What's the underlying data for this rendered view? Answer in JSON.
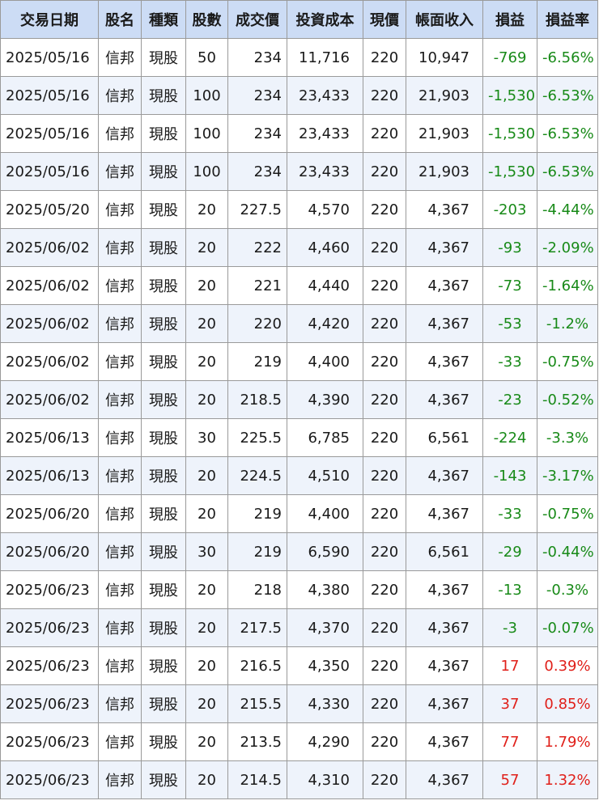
{
  "columns": [
    "交易日期",
    "股名",
    "種類",
    "股數",
    "成交價",
    "投資成本",
    "現價",
    "帳面收入",
    "損益",
    "損益率"
  ],
  "colors": {
    "header_bg": "#ccdcf5",
    "stock_name": "#1f3fcf",
    "type": "#e0201a",
    "loss": "#188a18",
    "gain": "#e0201a",
    "alt_row": "#eef3fb"
  },
  "rows": [
    {
      "date": "2025/05/16",
      "name": "信邦",
      "type": "現股",
      "shares": "50",
      "price": "234",
      "cost": "11,716",
      "current": "220",
      "book": "10,947",
      "pl": "-769",
      "plr": "-6.56%"
    },
    {
      "date": "2025/05/16",
      "name": "信邦",
      "type": "現股",
      "shares": "100",
      "price": "234",
      "cost": "23,433",
      "current": "220",
      "book": "21,903",
      "pl": "-1,530",
      "plr": "-6.53%"
    },
    {
      "date": "2025/05/16",
      "name": "信邦",
      "type": "現股",
      "shares": "100",
      "price": "234",
      "cost": "23,433",
      "current": "220",
      "book": "21,903",
      "pl": "-1,530",
      "plr": "-6.53%"
    },
    {
      "date": "2025/05/16",
      "name": "信邦",
      "type": "現股",
      "shares": "100",
      "price": "234",
      "cost": "23,433",
      "current": "220",
      "book": "21,903",
      "pl": "-1,530",
      "plr": "-6.53%"
    },
    {
      "date": "2025/05/20",
      "name": "信邦",
      "type": "現股",
      "shares": "20",
      "price": "227.5",
      "cost": "4,570",
      "current": "220",
      "book": "4,367",
      "pl": "-203",
      "plr": "-4.44%"
    },
    {
      "date": "2025/06/02",
      "name": "信邦",
      "type": "現股",
      "shares": "20",
      "price": "222",
      "cost": "4,460",
      "current": "220",
      "book": "4,367",
      "pl": "-93",
      "plr": "-2.09%"
    },
    {
      "date": "2025/06/02",
      "name": "信邦",
      "type": "現股",
      "shares": "20",
      "price": "221",
      "cost": "4,440",
      "current": "220",
      "book": "4,367",
      "pl": "-73",
      "plr": "-1.64%"
    },
    {
      "date": "2025/06/02",
      "name": "信邦",
      "type": "現股",
      "shares": "20",
      "price": "220",
      "cost": "4,420",
      "current": "220",
      "book": "4,367",
      "pl": "-53",
      "plr": "-1.2%"
    },
    {
      "date": "2025/06/02",
      "name": "信邦",
      "type": "現股",
      "shares": "20",
      "price": "219",
      "cost": "4,400",
      "current": "220",
      "book": "4,367",
      "pl": "-33",
      "plr": "-0.75%"
    },
    {
      "date": "2025/06/02",
      "name": "信邦",
      "type": "現股",
      "shares": "20",
      "price": "218.5",
      "cost": "4,390",
      "current": "220",
      "book": "4,367",
      "pl": "-23",
      "plr": "-0.52%"
    },
    {
      "date": "2025/06/13",
      "name": "信邦",
      "type": "現股",
      "shares": "30",
      "price": "225.5",
      "cost": "6,785",
      "current": "220",
      "book": "6,561",
      "pl": "-224",
      "plr": "-3.3%"
    },
    {
      "date": "2025/06/13",
      "name": "信邦",
      "type": "現股",
      "shares": "20",
      "price": "224.5",
      "cost": "4,510",
      "current": "220",
      "book": "4,367",
      "pl": "-143",
      "plr": "-3.17%"
    },
    {
      "date": "2025/06/20",
      "name": "信邦",
      "type": "現股",
      "shares": "20",
      "price": "219",
      "cost": "4,400",
      "current": "220",
      "book": "4,367",
      "pl": "-33",
      "plr": "-0.75%"
    },
    {
      "date": "2025/06/20",
      "name": "信邦",
      "type": "現股",
      "shares": "30",
      "price": "219",
      "cost": "6,590",
      "current": "220",
      "book": "6,561",
      "pl": "-29",
      "plr": "-0.44%"
    },
    {
      "date": "2025/06/23",
      "name": "信邦",
      "type": "現股",
      "shares": "20",
      "price": "218",
      "cost": "4,380",
      "current": "220",
      "book": "4,367",
      "pl": "-13",
      "plr": "-0.3%"
    },
    {
      "date": "2025/06/23",
      "name": "信邦",
      "type": "現股",
      "shares": "20",
      "price": "217.5",
      "cost": "4,370",
      "current": "220",
      "book": "4,367",
      "pl": "-3",
      "plr": "-0.07%"
    },
    {
      "date": "2025/06/23",
      "name": "信邦",
      "type": "現股",
      "shares": "20",
      "price": "216.5",
      "cost": "4,350",
      "current": "220",
      "book": "4,367",
      "pl": "17",
      "plr": "0.39%"
    },
    {
      "date": "2025/06/23",
      "name": "信邦",
      "type": "現股",
      "shares": "20",
      "price": "215.5",
      "cost": "4,330",
      "current": "220",
      "book": "4,367",
      "pl": "37",
      "plr": "0.85%"
    },
    {
      "date": "2025/06/23",
      "name": "信邦",
      "type": "現股",
      "shares": "20",
      "price": "213.5",
      "cost": "4,290",
      "current": "220",
      "book": "4,367",
      "pl": "77",
      "plr": "1.79%"
    },
    {
      "date": "2025/06/23",
      "name": "信邦",
      "type": "現股",
      "shares": "20",
      "price": "214.5",
      "cost": "4,310",
      "current": "220",
      "book": "4,367",
      "pl": "57",
      "plr": "1.32%"
    }
  ]
}
